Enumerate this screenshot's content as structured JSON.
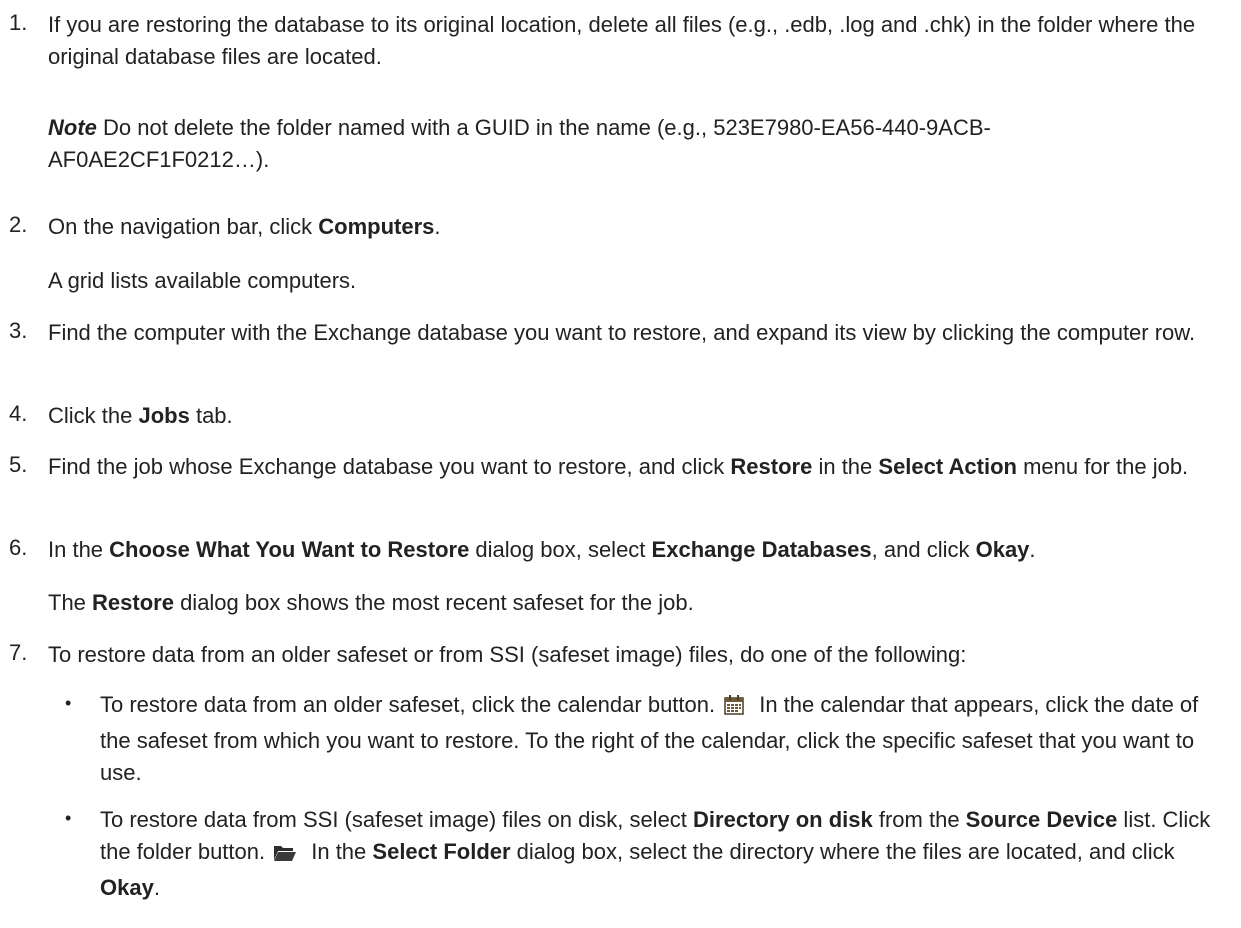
{
  "steps": [
    {
      "num": "1.",
      "segments": [
        {
          "t": "If you are restoring the database to its original location, delete all files (e.g., .edb, .log and .chk) in the folder where the original database files are located."
        }
      ]
    },
    {
      "num": "2.",
      "segments": [
        {
          "t": "On the navigation bar, click "
        },
        {
          "t": "Computers",
          "b": true
        },
        {
          "t": "."
        }
      ]
    },
    {
      "num": "3.",
      "segments": [
        {
          "t": "Find the computer with the Exchange database you want to restore, and expand its view by clicking the computer row."
        }
      ]
    },
    {
      "num": "4.",
      "segments": [
        {
          "t": "Click the "
        },
        {
          "t": "Jobs",
          "b": true
        },
        {
          "t": " tab."
        }
      ]
    },
    {
      "num": "5.",
      "segments": [
        {
          "t": "Find the job whose Exchange database you want to restore, and click "
        },
        {
          "t": "Restore",
          "b": true
        },
        {
          "t": " in the "
        },
        {
          "t": "Select Action",
          "b": true
        },
        {
          "t": " menu for the job."
        }
      ]
    },
    {
      "num": "6.",
      "segments": [
        {
          "t": "In the "
        },
        {
          "t": "Choose What You Want to Restore",
          "b": true
        },
        {
          "t": " dialog box, select "
        },
        {
          "t": "Exchange Databases",
          "b": true
        },
        {
          "t": ", and click "
        },
        {
          "t": "Okay",
          "b": true
        },
        {
          "t": "."
        }
      ]
    },
    {
      "num": "7.",
      "segments": [
        {
          "t": "To restore data from an older safeset or from SSI (safeset image) files, do one of the following:"
        }
      ]
    }
  ],
  "note": {
    "label": "Note",
    "text": " Do not delete the folder named with a GUID in the name (e.g., 523E7980-EA56-440-9ACB-AF0AE2CF1F0212…)."
  },
  "step2_result": "A grid lists available computers.",
  "step6_result": [
    {
      "t": "The "
    },
    {
      "t": "Restore",
      "b": true
    },
    {
      "t": " dialog box shows the most recent safeset for the job."
    }
  ],
  "bullets": [
    {
      "before": [
        {
          "t": "To restore data from an older safeset, click the calendar button."
        }
      ],
      "icon": "calendar-icon",
      "after": [
        {
          "t": " In the calendar that appears, click the date of the safeset from which you want to restore. To the right of the calendar, click the specific safeset that you want to use."
        }
      ]
    },
    {
      "before": [
        {
          "t": "To restore data from SSI (safeset image) files on disk, select "
        },
        {
          "t": "Directory on disk",
          "b": true
        },
        {
          "t": " from the "
        },
        {
          "t": "Source Device",
          "b": true
        },
        {
          "t": " list. Click the folder button."
        }
      ],
      "icon": "folder-open-icon",
      "after": [
        {
          "t": " In the "
        },
        {
          "t": "Select Folder",
          "b": true
        },
        {
          "t": " dialog box, select the directory where the files are located, and click "
        },
        {
          "t": "Okay",
          "b": true
        },
        {
          "t": "."
        }
      ]
    }
  ],
  "bullet_glyph": "•"
}
